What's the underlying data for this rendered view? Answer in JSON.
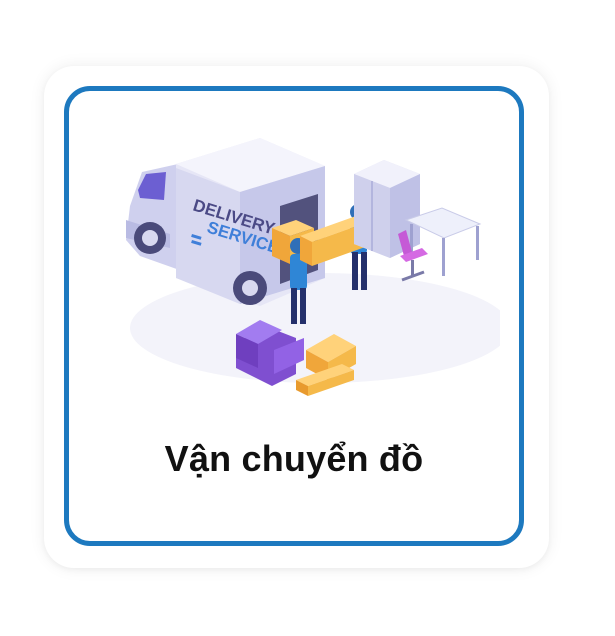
{
  "card": {
    "title": "Vận chuyển đồ",
    "illustration": {
      "icon": "moving-truck-illustration",
      "truck_text_line1": "DELIVERY",
      "truck_text_line2": "SERVICE"
    }
  },
  "colors": {
    "border": "#1d79bf",
    "truck_body": "#e3e3f4",
    "box": "#f5b94a",
    "sofa": "#8a55d8",
    "text": "#111111"
  }
}
